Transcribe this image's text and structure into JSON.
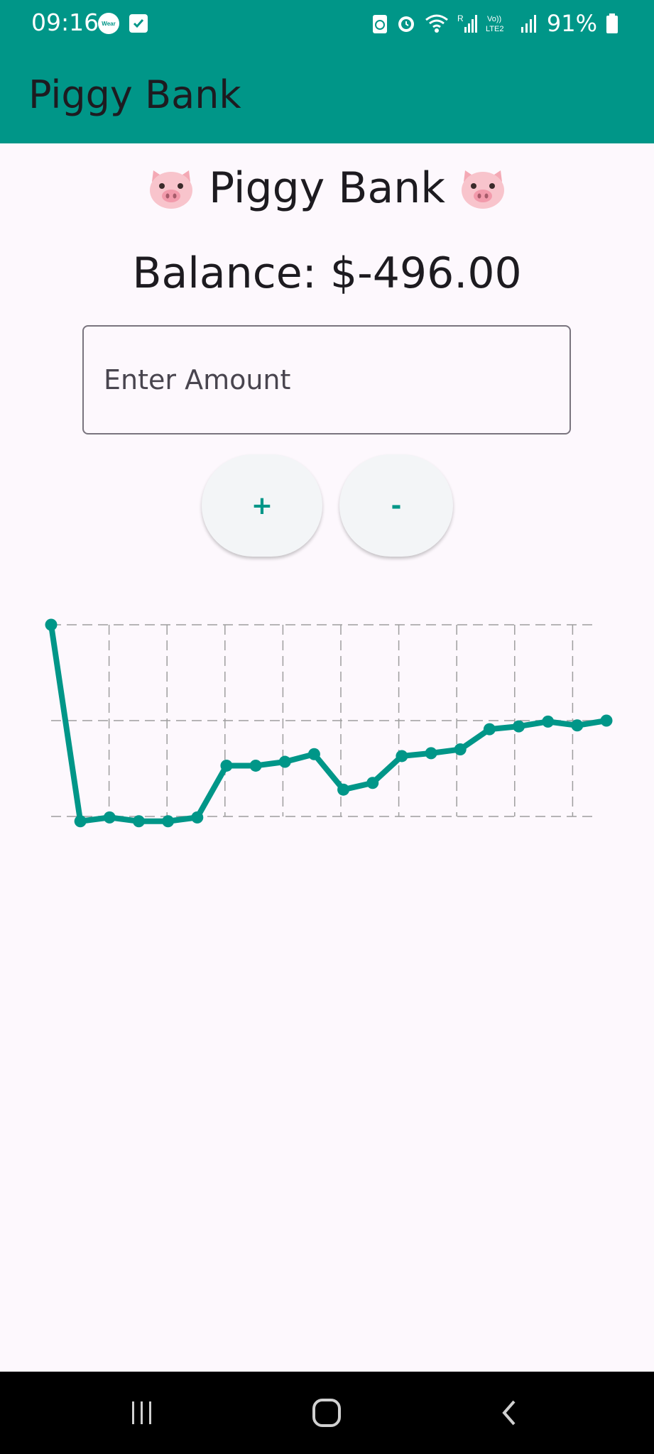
{
  "status_bar": {
    "time": "09:16",
    "wear_label": "Wear",
    "battery_percent": "91%",
    "icons": [
      "wear-app-icon",
      "task-check-icon",
      "storage-icon",
      "alarm-icon",
      "wifi-icon",
      "signal-r-icon",
      "volte-lte2-icon",
      "signal-icon",
      "battery-icon"
    ]
  },
  "app_bar": {
    "title": "Piggy Bank",
    "background": "#009688"
  },
  "main": {
    "title": "Piggy Bank",
    "title_icon": "pig-face-icon",
    "balance_text": "Balance: $-496.00",
    "amount_input": {
      "placeholder": "Enter Amount",
      "value": ""
    },
    "buttons": {
      "plus_label": "+",
      "minus_label": "-"
    }
  },
  "chart_data": {
    "type": "line",
    "title": "",
    "xlabel": "",
    "ylabel": "",
    "x": [
      1,
      2,
      3,
      4,
      5,
      6,
      7,
      8,
      9,
      10,
      11,
      12,
      13,
      14,
      15,
      16,
      17,
      18,
      19,
      20
    ],
    "values": [
      100,
      -105,
      -101,
      -105,
      -105,
      -101,
      -47,
      -47,
      -43,
      -35,
      -72,
      -65,
      -37,
      -34,
      -30,
      -9,
      -6,
      -1,
      -5,
      0
    ],
    "ylim": [
      -100,
      100
    ],
    "grid": true,
    "grid_style": "dashed",
    "line_color": "#009688",
    "axes_visible": false,
    "legend": "none"
  },
  "nav_bar": {
    "icons": [
      "recent-apps-icon",
      "home-icon",
      "back-icon"
    ]
  }
}
